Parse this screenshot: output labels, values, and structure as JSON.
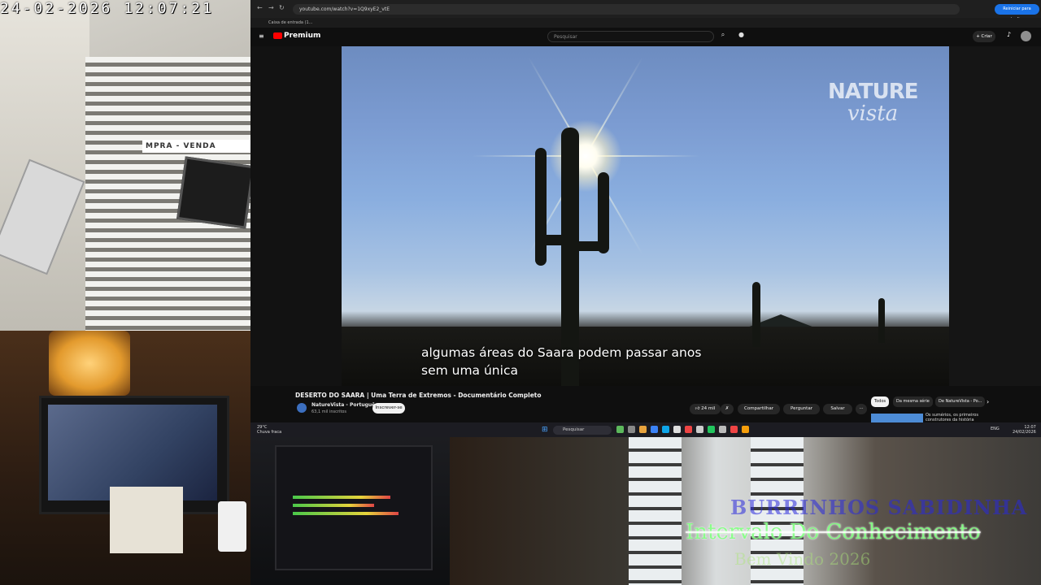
{
  "camera": {
    "timestamp": "24-02-2026  12:07:21",
    "store_sign": "MPRA - VENDA"
  },
  "browser": {
    "url": "youtube.com/watch?v=1Q9xyE2_vtE",
    "bookmark": "Caixa de entrada (1...",
    "reload_button": "Reiniciar para atualizar"
  },
  "youtube": {
    "logo": "Premium",
    "search_placeholder": "Pesquisar",
    "create_label": "+ Criar",
    "watermark": {
      "line1": "NATURE",
      "line2": "vista"
    },
    "subtitle": {
      "line1": "algumas áreas do Saara podem passar anos",
      "line2": "sem uma única"
    },
    "video_title": "DESERTO DO SAARA | Uma Terra de Extremos - Documentário Completo",
    "channel": {
      "name": "NatureVista - Português",
      "subs": "63,1 mil inscritos"
    },
    "subscribe_label": "Inscrever-se",
    "actions": {
      "likes": "24 mil",
      "share": "Compartilhar",
      "ask": "Perguntar",
      "save": "Salvar",
      "more": "···"
    },
    "chips": [
      "Todos",
      "Da mesma série",
      "De NatureVista - Po..."
    ],
    "recommendation_title": "Os sumérios, os primeiros construtores da história"
  },
  "taskbar": {
    "weather_temp": "29°C",
    "weather_desc": "Chuva fraca",
    "search_label": "Pesquisar",
    "lang": "ENG",
    "time": "12:07",
    "date": "24/02/2026"
  },
  "overlay": {
    "line1": "BURRINHOS SABIDINHA",
    "line2": "Intervalo Do Conhecimento",
    "line3": "Bem Vindo 2026"
  },
  "colors": {
    "yt_red": "#ff0000",
    "reload_blue": "#1a73e8",
    "overlay_green": "#78ff78"
  }
}
